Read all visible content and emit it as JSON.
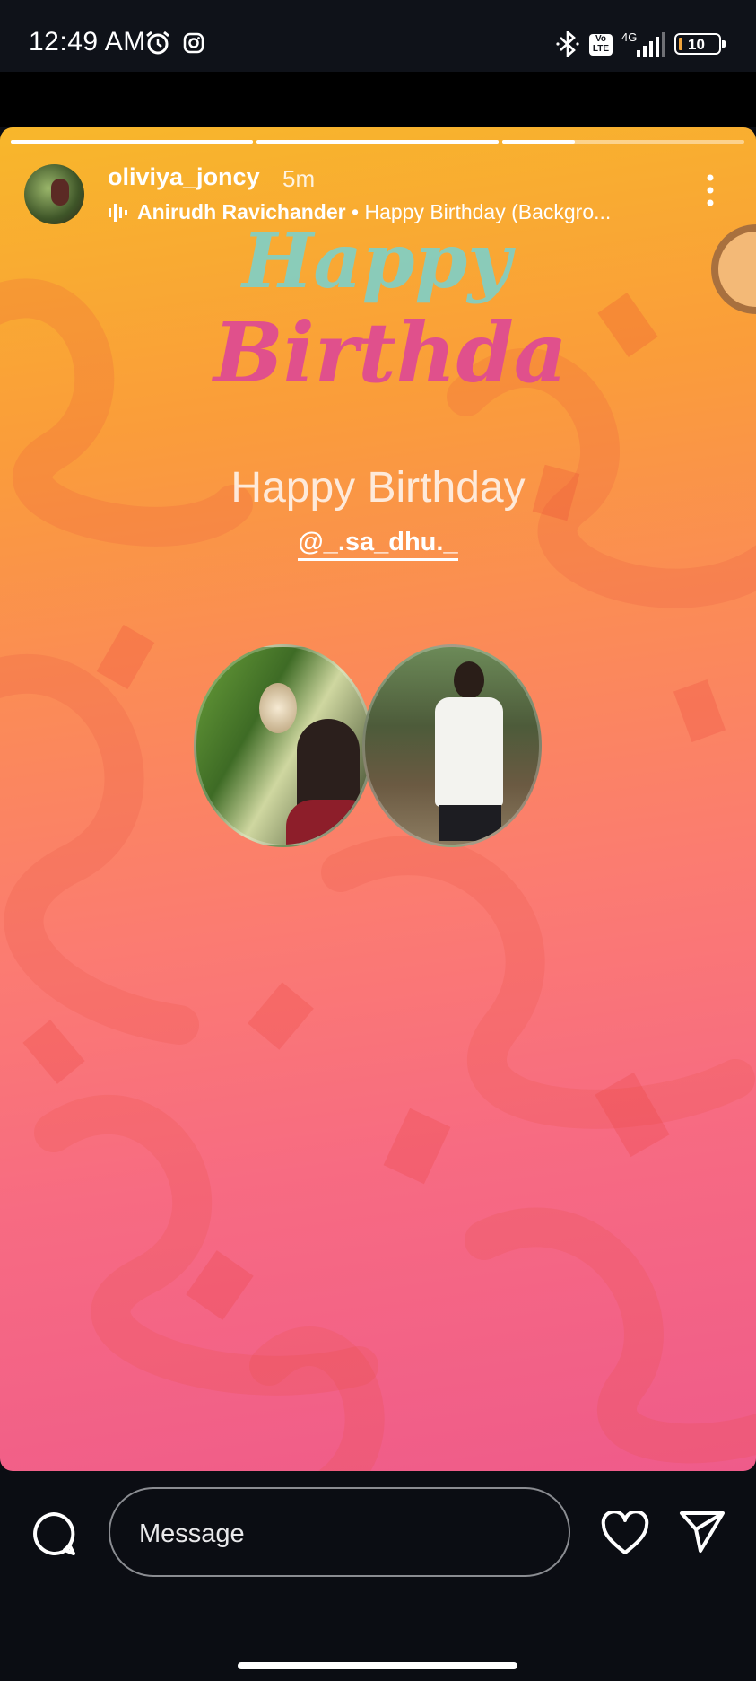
{
  "status_bar": {
    "time": "12:49 AM",
    "alarm_icon": "alarm-icon",
    "instagram_icon": "instagram-icon",
    "bluetooth_icon": "bluetooth-icon",
    "volte": "Vo LTE",
    "network": "4G",
    "battery": "10",
    "battery_color": "#f1a43b"
  },
  "story": {
    "segments": 3,
    "active_segment": 3,
    "active_progress": 0.3,
    "username": "oliviya_joncy",
    "time_ago": "5m",
    "music_artist": "Anirudh Ravichander",
    "music_separator": " • ",
    "music_title": "Happy Birthday (Backgro...",
    "sticker_title_1": "Happy",
    "sticker_title_2": "Birthday",
    "caption": "Happy Birthday",
    "mention": "@_.sa_dhu._",
    "gradient_colors": [
      "#f8b72b",
      "#fb8b57",
      "#ef5b8a"
    ]
  },
  "composer": {
    "message_placeholder": "Message",
    "reply_icon": "comment-bubble-icon",
    "like_icon": "heart-icon",
    "share_icon": "send-icon"
  }
}
